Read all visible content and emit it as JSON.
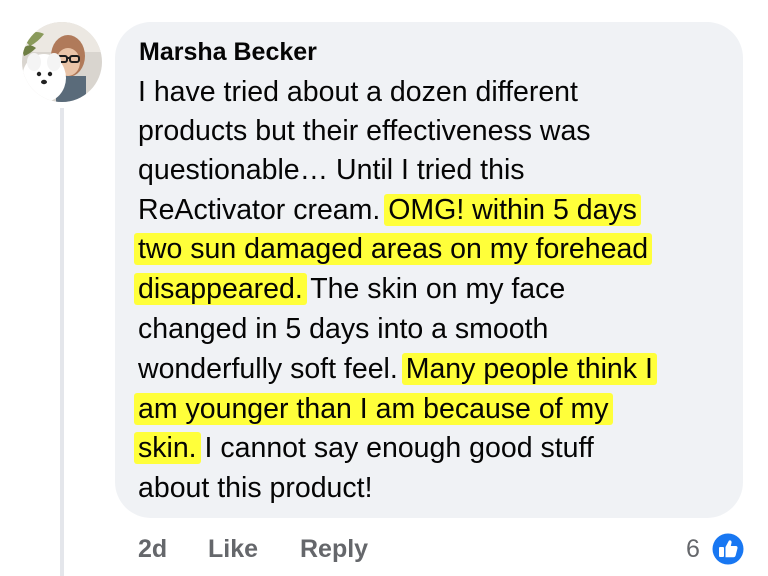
{
  "comment": {
    "author": "Marsha Becker",
    "lines": [
      [
        {
          "t": "I have tried about a dozen different",
          "hl": false
        }
      ],
      [
        {
          "t": "products but their effectiveness was",
          "hl": false
        }
      ],
      [
        {
          "t": "questionable… Until I tried this",
          "hl": false
        }
      ],
      [
        {
          "t": "ReActivator cream. ",
          "hl": false
        },
        {
          "t": "OMG! within 5 days",
          "hl": true
        }
      ],
      [
        {
          "t": "two sun damaged areas on my forehead",
          "hl": true
        }
      ],
      [
        {
          "t": "disappeared.",
          "hl": true
        },
        {
          "t": " The skin on my face",
          "hl": false
        }
      ],
      [
        {
          "t": "changed in 5 days into a smooth",
          "hl": false
        }
      ],
      [
        {
          "t": "wonderfully soft feel. ",
          "hl": false
        },
        {
          "t": "Many people think I",
          "hl": true
        }
      ],
      [
        {
          "t": "am younger than I am because of my",
          "hl": true
        }
      ],
      [
        {
          "t": "skin.",
          "hl": true
        },
        {
          "t": " I cannot say enough good stuff",
          "hl": false
        }
      ],
      [
        {
          "t": "about this product!",
          "hl": false
        }
      ]
    ]
  },
  "actions": {
    "timestamp": "2d",
    "like_label": "Like",
    "reply_label": "Reply"
  },
  "reactions": {
    "count": "6",
    "icon": "thumbs-up-icon"
  },
  "colors": {
    "bubble": "#f0f2f5",
    "highlight": "#ffff3a",
    "like_blue": "#1877f2",
    "meta_gray": "#65676b"
  }
}
